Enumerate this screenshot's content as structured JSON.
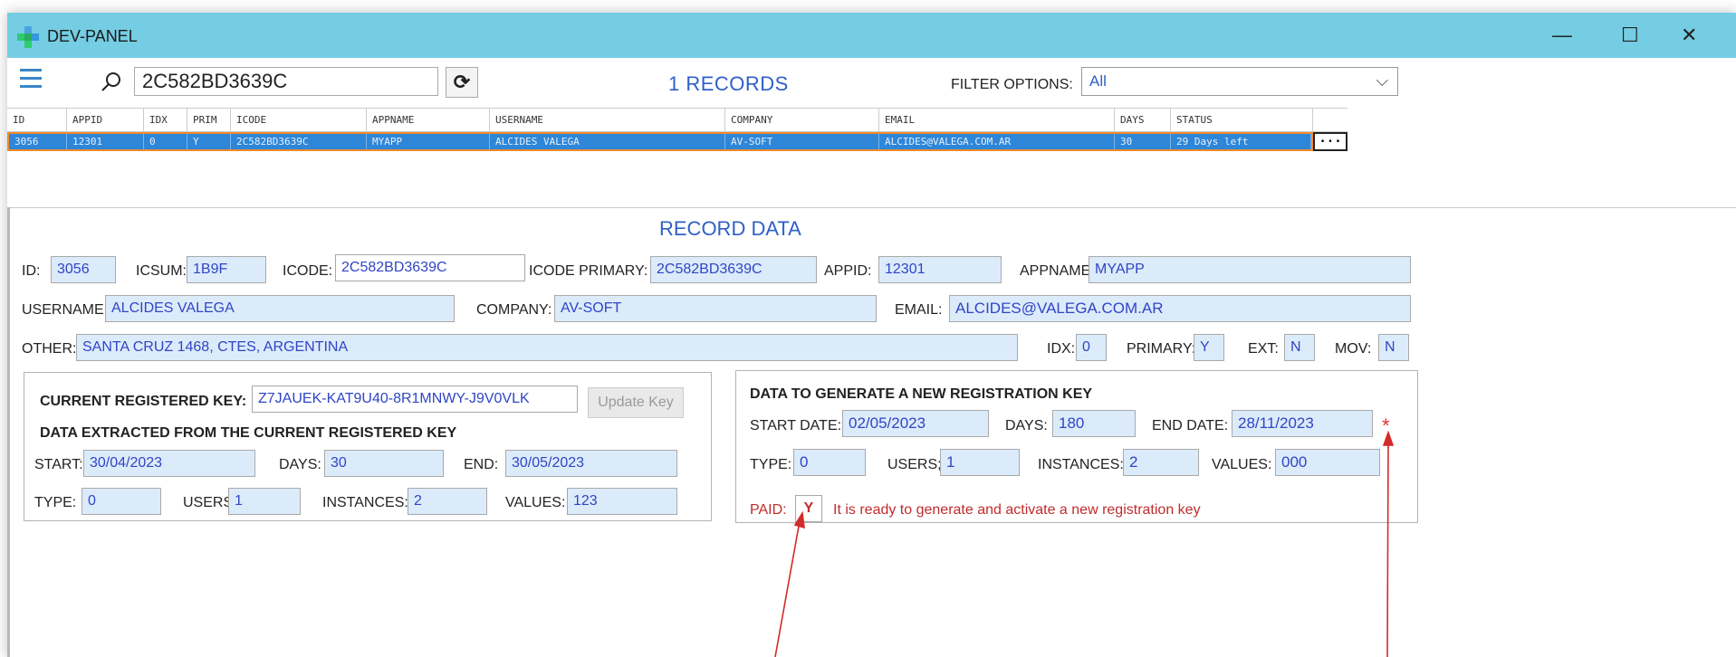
{
  "window": {
    "title": "DEV-PANEL",
    "minimize": "—",
    "maximize": "☐",
    "close": "✕"
  },
  "toolbar": {
    "search_value": "2C582BD3639C",
    "records_label": "1 RECORDS",
    "filter_label": "FILTER OPTIONS:",
    "filter_value": "All"
  },
  "grid": {
    "columns": [
      "ID",
      "APPID",
      "IDX",
      "PRIM",
      "ICODE",
      "APPNAME",
      "USERNAME",
      "COMPANY",
      "EMAIL",
      "DAYS",
      "STATUS"
    ],
    "row": [
      "3056",
      "12301",
      "0",
      "Y",
      "2C582BD3639C",
      "MYAPP",
      "ALCIDES VALEGA",
      "AV-SOFT",
      "ALCIDES@VALEGA.COM.AR",
      "30",
      "29 Days left"
    ],
    "row_button": "..."
  },
  "record": {
    "section_title": "RECORD DATA",
    "id_label": "ID:",
    "id": "3056",
    "icsum_label": "ICSUM:",
    "icsum": "1B9F",
    "icode_label": "ICODE:",
    "icode": "2C582BD3639C",
    "icode_primary_label": "ICODE PRIMARY:",
    "icode_primary": "2C582BD3639C",
    "appid_label": "APPID:",
    "appid": "12301",
    "appname_label": "APPNAME:",
    "appname": "MYAPP",
    "username_label": "USERNAME:",
    "username": "ALCIDES VALEGA",
    "company_label": "COMPANY:",
    "company": "AV-SOFT",
    "email_label": "EMAIL:",
    "email": "ALCIDES@VALEGA.COM.AR",
    "other_label": "OTHER:",
    "other": "SANTA CRUZ 1468, CTES, ARGENTINA",
    "idx_label": "IDX:",
    "idx": "0",
    "primary_label": "PRIMARY:",
    "primary": "Y",
    "ext_label": "EXT:",
    "ext": "N",
    "mov_label": "MOV:",
    "mov": "N"
  },
  "current_key": {
    "label": "CURRENT REGISTERED KEY:",
    "value": "Z7JAUEK-KAT9U40-8R1MNWY-J9V0VLK",
    "update_button": "Update Key",
    "extracted_title": "DATA EXTRACTED FROM THE CURRENT REGISTERED KEY",
    "start_label": "START:",
    "start": "30/04/2023",
    "days_label": "DAYS:",
    "days": "30",
    "end_label": "END:",
    "end": "30/05/2023",
    "type_label": "TYPE:",
    "type": "0",
    "users_label": "USERS;",
    "users": "1",
    "instances_label": "INSTANCES:",
    "instances": "2",
    "values_label": "VALUES:",
    "values": "123"
  },
  "new_key": {
    "title": "DATA TO GENERATE A NEW REGISTRATION KEY",
    "start_label": "START DATE:",
    "start": "02/05/2023",
    "days_label": "DAYS:",
    "days": "180",
    "end_label": "END DATE:",
    "end": "28/11/2023",
    "asterisk": "*",
    "type_label": "TYPE:",
    "type": "0",
    "users_label": "USERS;",
    "users": "1",
    "instances_label": "INSTANCES:",
    "instances": "2",
    "values_label": "VALUES:",
    "values": "000",
    "paid_label": "PAID:",
    "paid": "Y",
    "ready_message": "It is ready to generate and activate a new registration key"
  },
  "colors": {
    "titlebar": "#74cde3",
    "accent_blue": "#2f5fc8",
    "selected_row": "#2e86d8",
    "row_border": "#f08a2a",
    "field_bg": "#dcebfa",
    "warning_red": "#c02c2c"
  }
}
